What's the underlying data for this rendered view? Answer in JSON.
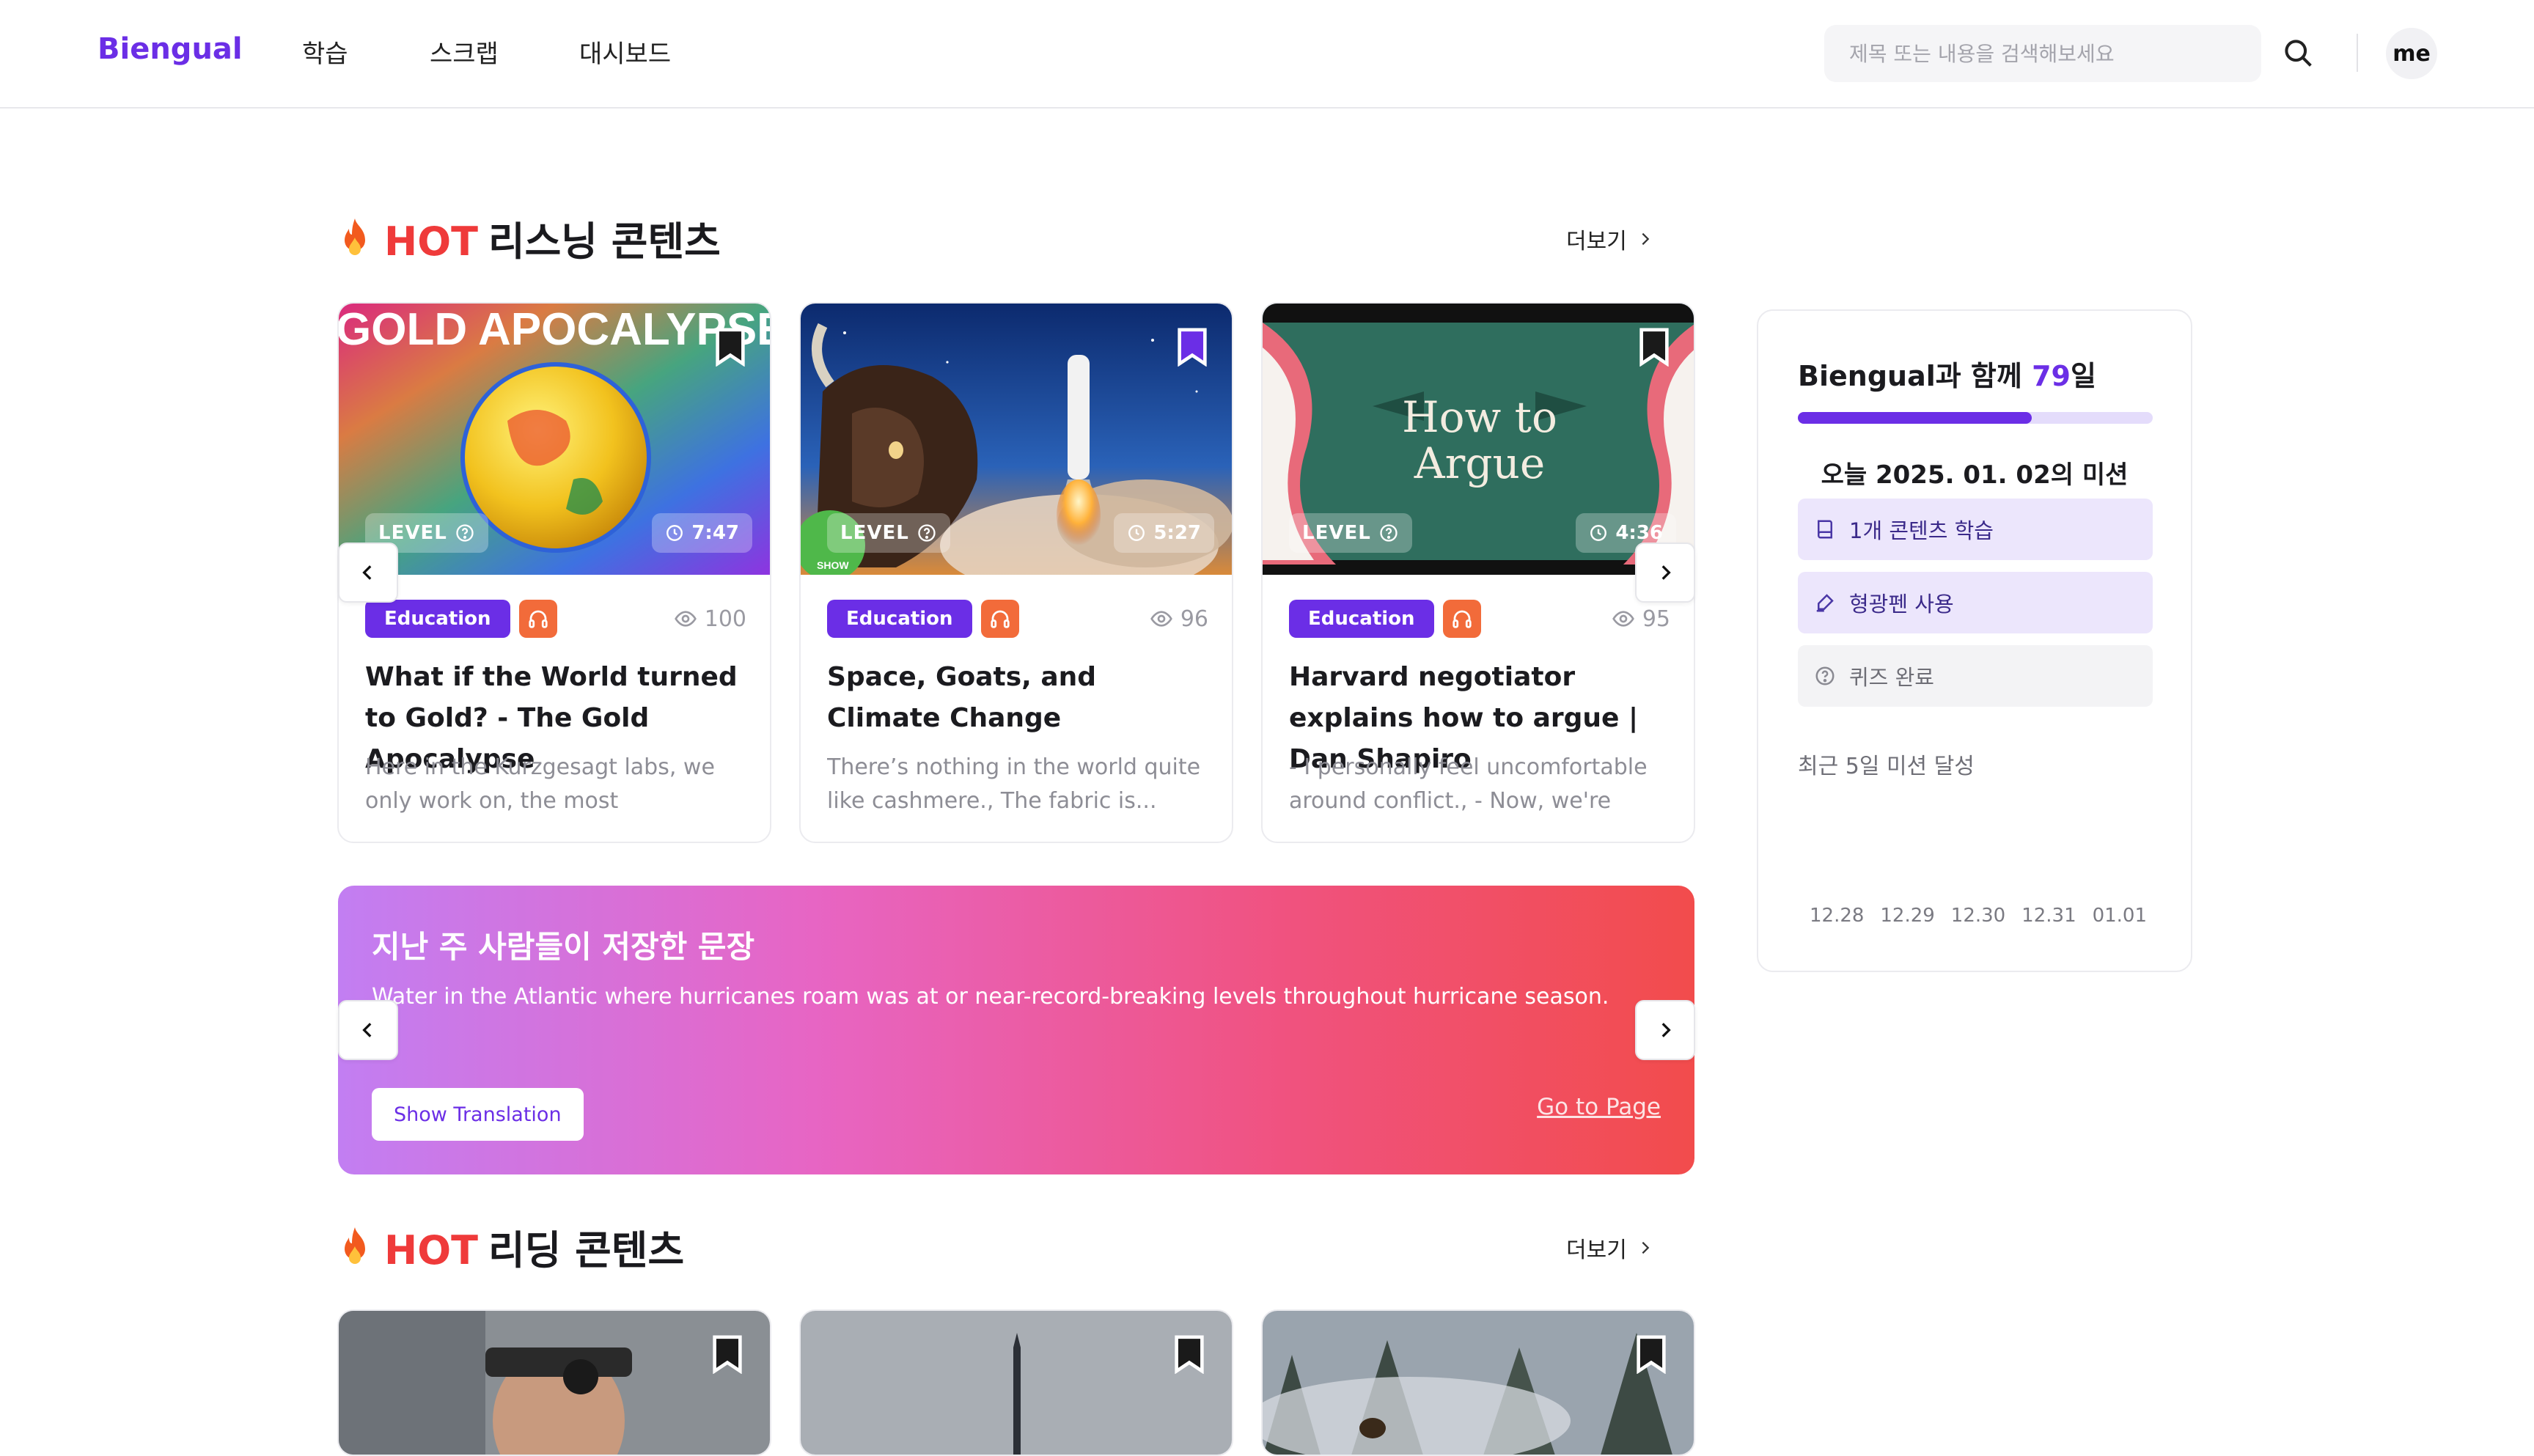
{
  "header": {
    "logo": "Biengual",
    "nav": [
      "학습",
      "스크랩",
      "대시보드"
    ],
    "search_placeholder": "제목 또는 내용을 검색해보세요",
    "avatar_label": "me"
  },
  "listening": {
    "hot": "HOT",
    "title": "리스닝 콘텐츠",
    "more": "더보기",
    "cards": [
      {
        "level": "LEVEL",
        "duration": "7:47",
        "category": "Education",
        "views": "100",
        "title": "What if the World turned to Gold? - The Gold Apocalypse",
        "desc": "Here in the Kurzgesagt labs, we only work on, the most important...",
        "thumb_text": "GOLD APOCALYPSE"
      },
      {
        "level": "LEVEL",
        "duration": "5:27",
        "category": "Education",
        "views": "96",
        "title": "Space, Goats, and Climate Change",
        "desc": "There’s nothing in the world quite like cashmere., The fabric is...",
        "thumb_text": "SHOW"
      },
      {
        "level": "LEVEL",
        "duration": "4:36",
        "category": "Education",
        "views": "95",
        "title": "Harvard negotiator explains how to argue | Dan Shapiro",
        "desc": "- I personally feel uncomfortable around conflict., - Now, we're here...",
        "thumb_text": "How to Argue"
      }
    ]
  },
  "banner": {
    "title": "지난 주 사람들이 저장한 문장",
    "sentence": "Water in the Atlantic where hurricanes roam was at or near-record-breaking levels throughout hurricane season.",
    "translate_label": "Show Translation",
    "goto_label": "Go to Page"
  },
  "reading": {
    "hot": "HOT",
    "title": "리딩 콘텐츠",
    "more": "더보기"
  },
  "panel": {
    "title_prefix": "Biengual과 함께 ",
    "days": "79",
    "title_suffix": "일",
    "progress": 0.66,
    "mission_title": "오늘 2025. 01. 02의 미션",
    "missions": [
      {
        "label": "1개 콘텐츠 학습",
        "done": true
      },
      {
        "label": "형광펜 사용",
        "done": true
      },
      {
        "label": "퀴즈 완료",
        "done": false
      }
    ],
    "recent_label": "최근 5일 미션 달성",
    "dates": [
      "12.28",
      "12.29",
      "12.30",
      "12.31",
      "01.01"
    ]
  },
  "colors": {
    "brand": "#6b2ee6",
    "hot": "#ef3a3a",
    "audio": "#f26b3a"
  }
}
